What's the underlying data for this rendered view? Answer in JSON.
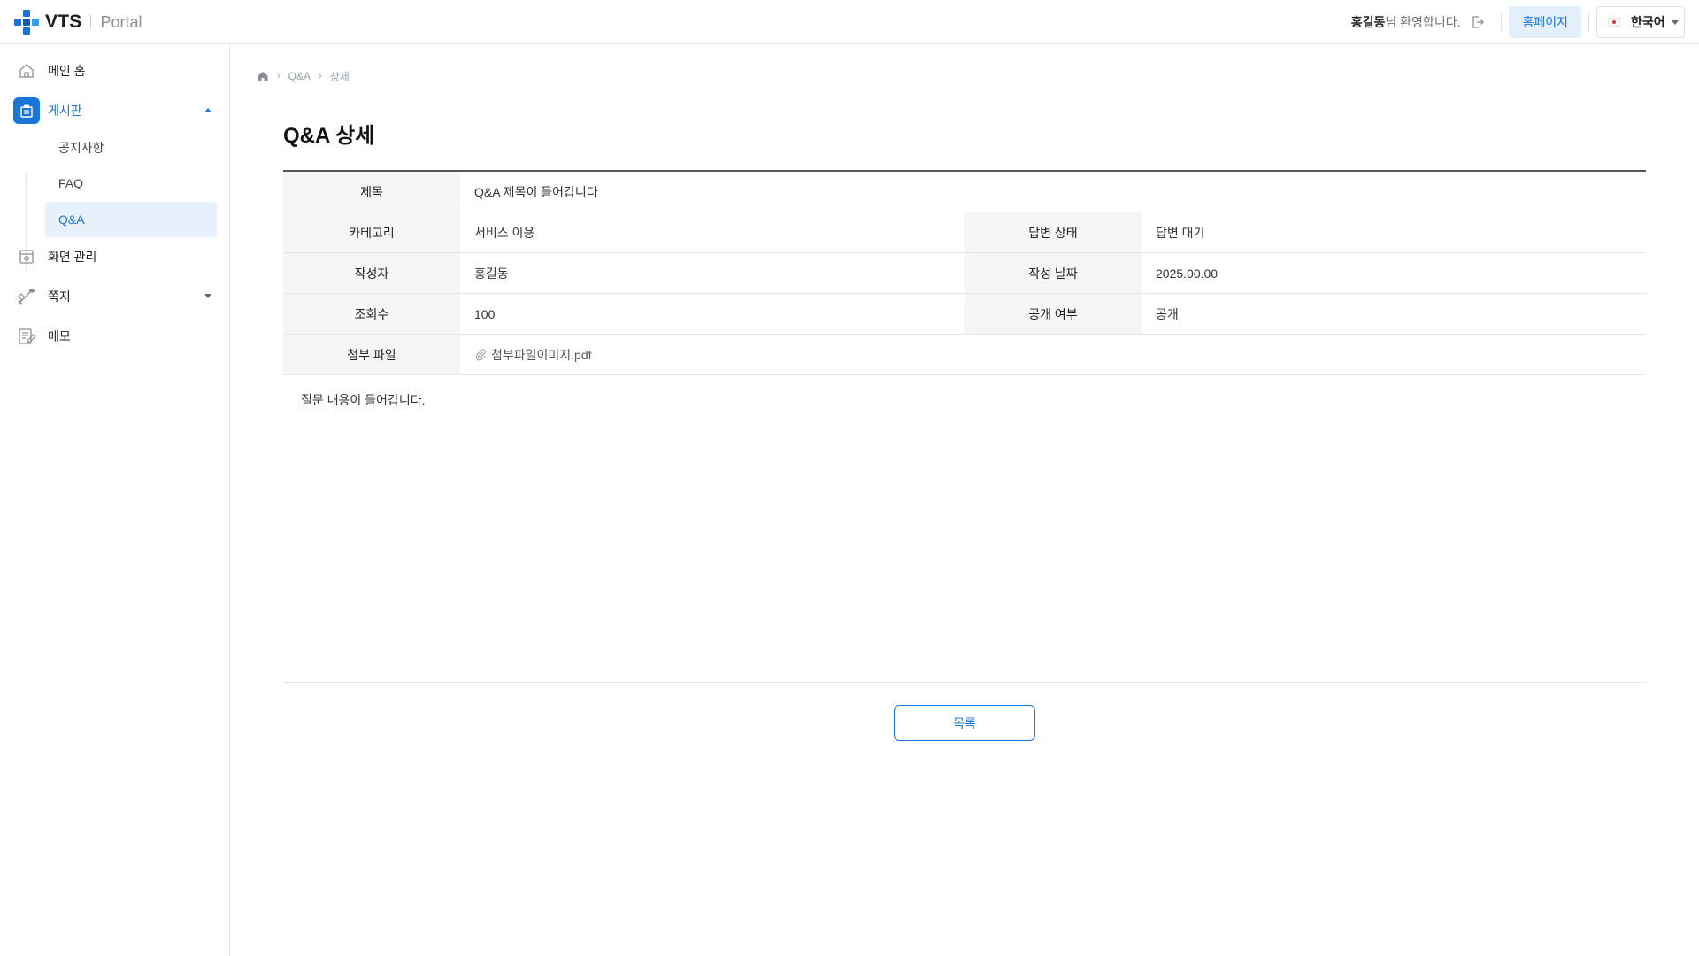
{
  "header": {
    "logo_text": "VTS",
    "logo_sub": "Portal",
    "user_name": "홍길동",
    "welcome_suffix": "님 환영합니다.",
    "homepage_label": "홈페이지",
    "language_label": "한국어"
  },
  "sidebar": {
    "items": [
      {
        "label": "메인 홈",
        "icon": "home-icon"
      },
      {
        "label": "게시판",
        "icon": "board-icon"
      },
      {
        "label": "화면 관리",
        "icon": "screen-manage-icon"
      },
      {
        "label": "쪽지",
        "icon": "message-icon"
      },
      {
        "label": "메모",
        "icon": "memo-icon"
      }
    ],
    "sub_items": [
      {
        "label": "공지사항"
      },
      {
        "label": "FAQ"
      },
      {
        "label": "Q&A"
      }
    ]
  },
  "breadcrumb": {
    "items": [
      "Q&A",
      "상세"
    ]
  },
  "page": {
    "title": "Q&A 상세"
  },
  "detail": {
    "title_label": "제목",
    "title_value": "Q&A 제목이 들어갑니다",
    "category_label": "카테고리",
    "category_value": "서비스 이용",
    "answer_status_label": "답변 상태",
    "answer_status_value": "답변 대기",
    "author_label": "작성자",
    "author_value": "홍길동",
    "date_label": "작성 날짜",
    "date_value": "2025.00.00",
    "views_label": "조회수",
    "views_value": "100",
    "public_label": "공개 여부",
    "public_value": "공개",
    "attachment_label": "첨부 파일",
    "attachment_value": "첨부파일이미지.pdf"
  },
  "content": {
    "body": "질문 내용이 들어갑니다."
  },
  "actions": {
    "list_label": "목록"
  },
  "colors": {
    "accent": "#1b74d8",
    "accent_light": "#e7f1fc",
    "th_bg": "#f4f5f6"
  }
}
